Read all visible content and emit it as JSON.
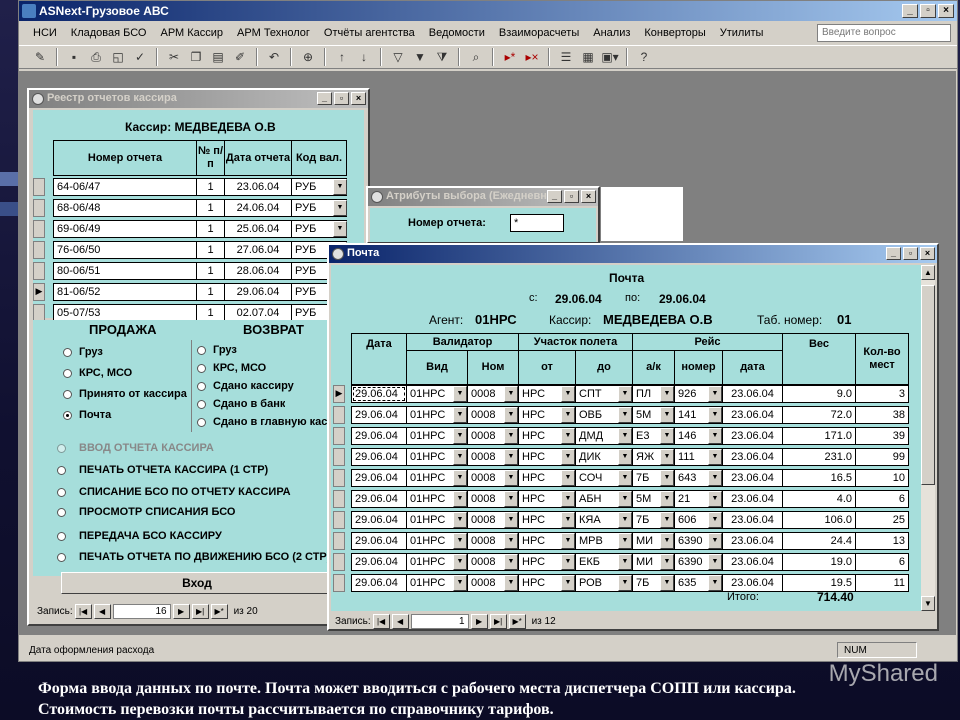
{
  "app": {
    "title": "ASNext-Грузовое АВС",
    "menu": [
      "НСИ",
      "Кладовая БСО",
      "АРМ Кассир",
      "АРМ Технолог",
      "Отчёты агентства",
      "Ведомости",
      "Взаиморасчеты",
      "Анализ",
      "Конверторы",
      "Утилиты"
    ],
    "ask_placeholder": "Введите вопрос",
    "status_text": "Дата оформления расхода",
    "status_num": "NUM"
  },
  "registry": {
    "title": "Реестр отчетов кассира",
    "cashier_label": "Кассир: МЕДВЕДЕВА О.В",
    "headers": {
      "num": "Номер отчета",
      "pp": "№ п/п",
      "date": "Дата отчета",
      "cur": "Код вал."
    },
    "rows": [
      {
        "num": "64-06/47",
        "pp": "1",
        "date": "23.06.04",
        "cur": "РУБ"
      },
      {
        "num": "68-06/48",
        "pp": "1",
        "date": "24.06.04",
        "cur": "РУБ"
      },
      {
        "num": "69-06/49",
        "pp": "1",
        "date": "25.06.04",
        "cur": "РУБ"
      },
      {
        "num": "76-06/50",
        "pp": "1",
        "date": "27.06.04",
        "cur": "РУБ"
      },
      {
        "num": "80-06/51",
        "pp": "1",
        "date": "28.06.04",
        "cur": "РУБ"
      },
      {
        "num": "81-06/52",
        "pp": "1",
        "date": "29.06.04",
        "cur": "РУБ"
      },
      {
        "num": "05-07/53",
        "pp": "1",
        "date": "02.07.04",
        "cur": "РУБ"
      }
    ],
    "sale_title": "ПРОДАЖА",
    "return_title": "ВОЗВРАТ",
    "sale_options": [
      "Груз",
      "КРС, МСО",
      "Принято от кассира",
      "Почта"
    ],
    "return_options": [
      "Груз",
      "КРС, МСО",
      "Сдано кассиру",
      "Сдано в банк",
      "Сдано в главную касс"
    ],
    "actions": [
      "ВВОД ОТЧЕТА КАССИРА",
      "ПЕЧАТЬ ОТЧЕТА КАССИРА (1 СТР)",
      "СПИСАНИЕ БСО ПО ОТЧЕТУ КАССИРА",
      "ПРОСМОТР СПИСАНИЯ БСО",
      "ПЕРЕДАЧА БСО КАССИРУ",
      "ПЕЧАТЬ ОТЧЕТА ПО ДВИЖЕНИЮ БСО (2 СТР)"
    ],
    "enter_button": "Вход",
    "record_label": "Запись:",
    "record_current": "16",
    "record_total": "из 20"
  },
  "attributes": {
    "title": "Атрибуты выбора (Ежедневн...",
    "report_num_label": "Номер отчета:",
    "report_num_value": "*"
  },
  "post": {
    "title": "Почта",
    "heading": "Почта",
    "from_label": "с:",
    "from_date": "29.06.04",
    "to_label": "по:",
    "to_date": "29.06.04",
    "agent_label": "Агент:",
    "agent_value": "01НРС",
    "cashier_label": "Кассир:",
    "cashier_value": "МЕДВЕДЕВА О.В",
    "tab_label": "Таб. номер:",
    "tab_value": "01",
    "headers": {
      "date": "Дата",
      "validator": "Валидатор",
      "kind": "Вид",
      "nom": "Ном",
      "segment": "Участок полета",
      "from": "от",
      "to": "до",
      "flight": "Рейс",
      "ak": "а/к",
      "number": "номер",
      "fdate": "дата",
      "weight": "Вес",
      "places": "Кол-во мест"
    },
    "rows": [
      {
        "date": "29.06.04",
        "kind": "01НРС",
        "nom": "0008",
        "from": "НРС",
        "to": "СПТ",
        "ak": "ПЛ",
        "num": "926",
        "fdate": "23.06.04",
        "weight": "9.0",
        "places": "3"
      },
      {
        "date": "29.06.04",
        "kind": "01НРС",
        "nom": "0008",
        "from": "НРС",
        "to": "ОВБ",
        "ak": "5М",
        "num": "141",
        "fdate": "23.06.04",
        "weight": "72.0",
        "places": "38"
      },
      {
        "date": "29.06.04",
        "kind": "01НРС",
        "nom": "0008",
        "from": "НРС",
        "to": "ДМД",
        "ak": "Е3",
        "num": "146",
        "fdate": "23.06.04",
        "weight": "171.0",
        "places": "39"
      },
      {
        "date": "29.06.04",
        "kind": "01НРС",
        "nom": "0008",
        "from": "НРС",
        "to": "ДИК",
        "ak": "ЯЖ",
        "num": "111",
        "fdate": "23.06.04",
        "weight": "231.0",
        "places": "99"
      },
      {
        "date": "29.06.04",
        "kind": "01НРС",
        "nom": "0008",
        "from": "НРС",
        "to": "СОЧ",
        "ak": "7Б",
        "num": "643",
        "fdate": "23.06.04",
        "weight": "16.5",
        "places": "10"
      },
      {
        "date": "29.06.04",
        "kind": "01НРС",
        "nom": "0008",
        "from": "НРС",
        "to": "АБН",
        "ak": "5М",
        "num": "21",
        "fdate": "23.06.04",
        "weight": "4.0",
        "places": "6"
      },
      {
        "date": "29.06.04",
        "kind": "01НРС",
        "nom": "0008",
        "from": "НРС",
        "to": "КЯА",
        "ak": "7Б",
        "num": "606",
        "fdate": "23.06.04",
        "weight": "106.0",
        "places": "25"
      },
      {
        "date": "29.06.04",
        "kind": "01НРС",
        "nom": "0008",
        "from": "НРС",
        "to": "МРВ",
        "ak": "МИ",
        "num": "6390",
        "fdate": "23.06.04",
        "weight": "24.4",
        "places": "13"
      },
      {
        "date": "29.06.04",
        "kind": "01НРС",
        "nom": "0008",
        "from": "НРС",
        "to": "ЕКБ",
        "ak": "МИ",
        "num": "6390",
        "fdate": "23.06.04",
        "weight": "19.0",
        "places": "6"
      },
      {
        "date": "29.06.04",
        "kind": "01НРС",
        "nom": "0008",
        "from": "НРС",
        "to": "РОВ",
        "ak": "7Б",
        "num": "635",
        "fdate": "23.06.04",
        "weight": "19.5",
        "places": "11"
      }
    ],
    "total_label": "Итого:",
    "total_value": "714.40",
    "record_label": "Запись:",
    "record_current": "1",
    "record_total": "из 12"
  },
  "caption": {
    "line1": "Форма ввода данных по почте. Почта может вводиться с рабочего места диспетчера СОПП или кассира.",
    "line2": "Стоимость перевозки почты рассчитывается по справочнику тарифов."
  },
  "watermark": "MyShared"
}
